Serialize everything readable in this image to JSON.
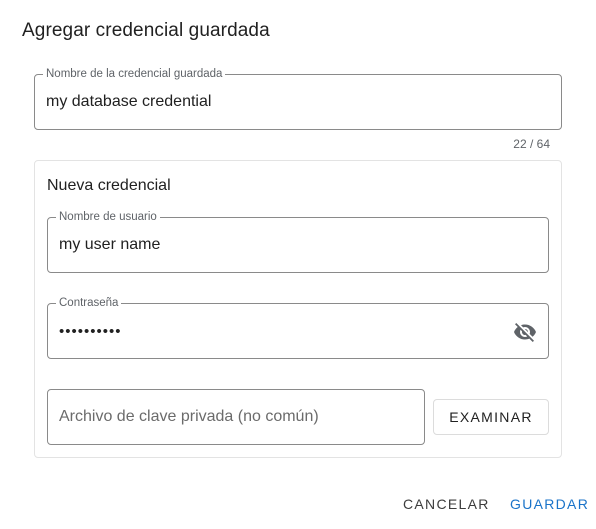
{
  "dialog": {
    "title": "Agregar credencial guardada"
  },
  "credential_name": {
    "label": "Nombre de la credencial guardada",
    "value": "my database credential",
    "counter": "22 / 64"
  },
  "new_credential": {
    "title": "Nueva credencial",
    "username": {
      "label": "Nombre de usuario",
      "value": "my user name"
    },
    "password": {
      "label": "Contraseña",
      "value": "••••••••••",
      "toggle_icon": "eye-off-icon"
    },
    "private_key": {
      "placeholder": "Archivo de clave privada (no común)"
    },
    "browse_label": "EXAMINAR"
  },
  "actions": {
    "cancel_label": "CANCELAR",
    "save_label": "GUARDAR"
  },
  "colors": {
    "accent": "#1a73c9",
    "border": "#8a8a8a",
    "panel_border": "#e3e3e3"
  }
}
